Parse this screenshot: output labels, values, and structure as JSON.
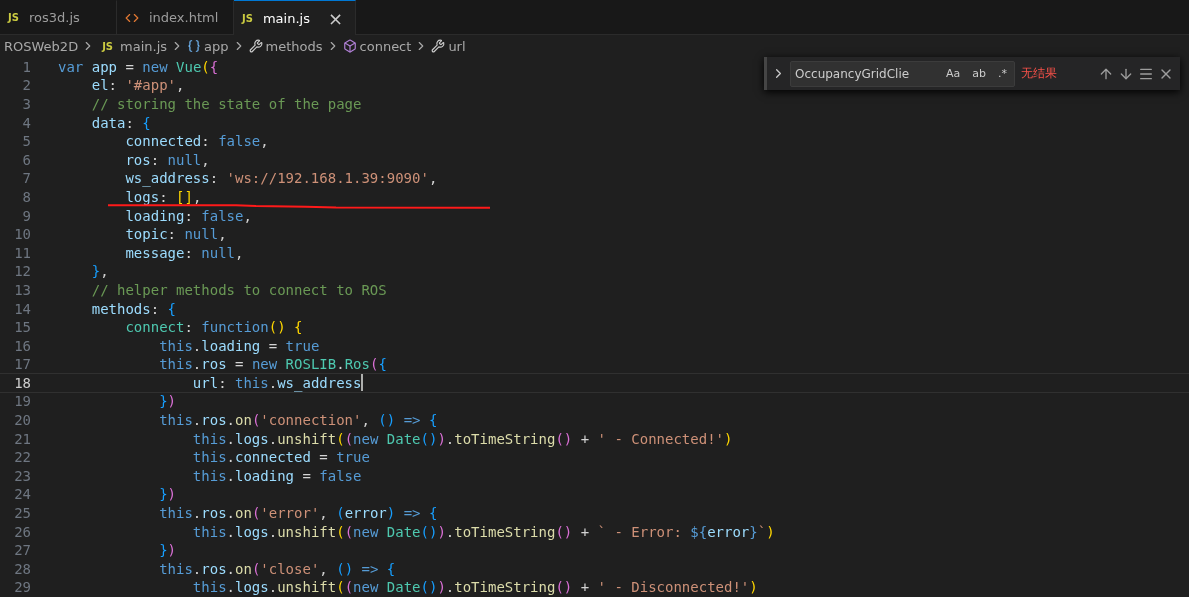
{
  "tabs": [
    {
      "label": "ros3d.js",
      "kind": "js",
      "icon_text": "JS",
      "selected": false
    },
    {
      "label": "index.html",
      "kind": "html",
      "selected": false
    },
    {
      "label": "main.js",
      "kind": "js",
      "icon_text": "JS",
      "selected": true,
      "close": "×"
    }
  ],
  "breadcrumb": [
    {
      "label": "ROSWeb2D",
      "kind": "folder"
    },
    {
      "label": "main.js",
      "kind": "js",
      "icon_text": "JS"
    },
    {
      "label": "app",
      "kind": "variable"
    },
    {
      "label": "methods",
      "kind": "wrench"
    },
    {
      "label": "connect",
      "kind": "cube"
    },
    {
      "label": "url",
      "kind": "wrench"
    }
  ],
  "find_widget": {
    "value": "OccupancyGridClie",
    "toggles": [
      {
        "label": "Aa",
        "selected": false
      },
      {
        "label": "ab",
        "selected": false
      },
      {
        "label": ".*",
        "selected": false
      }
    ],
    "status": "无结果"
  },
  "code_lines": [
    {
      "number": "1",
      "selected": false,
      "tokens": [
        {
          "kind": "kw",
          "text": "var"
        },
        {
          "kind": "var",
          "text": " app"
        },
        {
          "kind": "p",
          "text": " = "
        },
        {
          "kind": "kw",
          "text": "new"
        },
        {
          "kind": "cls",
          "text": " Vue"
        },
        {
          "kind": "b1",
          "text": "("
        },
        {
          "kind": "b2",
          "text": "{"
        }
      ]
    },
    {
      "number": "2",
      "selected": false,
      "tokens": [
        {
          "kind": "var",
          "text": "    el"
        },
        {
          "kind": "p",
          "text": ": "
        },
        {
          "kind": "str",
          "text": "'#app'"
        },
        {
          "kind": "p",
          "text": ","
        }
      ]
    },
    {
      "number": "3",
      "selected": false,
      "tokens": [
        {
          "kind": "com",
          "text": "    // storing the state of the page"
        }
      ]
    },
    {
      "number": "4",
      "selected": false,
      "tokens": [
        {
          "kind": "var",
          "text": "    data"
        },
        {
          "kind": "p",
          "text": ": "
        },
        {
          "kind": "b3",
          "text": "{"
        }
      ]
    },
    {
      "number": "5",
      "selected": false,
      "tokens": [
        {
          "kind": "var",
          "text": "        connected"
        },
        {
          "kind": "p",
          "text": ": "
        },
        {
          "kind": "kw",
          "text": "false"
        },
        {
          "kind": "p",
          "text": ","
        }
      ]
    },
    {
      "number": "6",
      "selected": false,
      "tokens": [
        {
          "kind": "var",
          "text": "        ros"
        },
        {
          "kind": "p",
          "text": ": "
        },
        {
          "kind": "kw",
          "text": "null"
        },
        {
          "kind": "p",
          "text": ","
        }
      ]
    },
    {
      "number": "7",
      "selected": false,
      "tokens": [
        {
          "kind": "var",
          "text": "        ws_address"
        },
        {
          "kind": "p",
          "text": ": "
        },
        {
          "kind": "str",
          "text": "'ws://192.168.1.39:9090'"
        },
        {
          "kind": "p",
          "text": ","
        }
      ]
    },
    {
      "number": "8",
      "selected": false,
      "tokens": [
        {
          "kind": "var",
          "text": "        logs"
        },
        {
          "kind": "p",
          "text": ": "
        },
        {
          "kind": "b1",
          "text": "[]"
        },
        {
          "kind": "p",
          "text": ","
        }
      ]
    },
    {
      "number": "9",
      "selected": false,
      "tokens": [
        {
          "kind": "var",
          "text": "        loading"
        },
        {
          "kind": "p",
          "text": ": "
        },
        {
          "kind": "kw",
          "text": "false"
        },
        {
          "kind": "p",
          "text": ","
        }
      ]
    },
    {
      "number": "10",
      "selected": false,
      "tokens": [
        {
          "kind": "var",
          "text": "        topic"
        },
        {
          "kind": "p",
          "text": ": "
        },
        {
          "kind": "kw",
          "text": "null"
        },
        {
          "kind": "p",
          "text": ","
        }
      ]
    },
    {
      "number": "11",
      "selected": false,
      "tokens": [
        {
          "kind": "var",
          "text": "        message"
        },
        {
          "kind": "p",
          "text": ": "
        },
        {
          "kind": "kw",
          "text": "null"
        },
        {
          "kind": "p",
          "text": ","
        }
      ]
    },
    {
      "number": "12",
      "selected": false,
      "tokens": [
        {
          "kind": "b3",
          "text": "    }"
        },
        {
          "kind": "p",
          "text": ","
        }
      ]
    },
    {
      "number": "13",
      "selected": false,
      "tokens": [
        {
          "kind": "com",
          "text": "    // helper methods to connect to ROS"
        }
      ]
    },
    {
      "number": "14",
      "selected": false,
      "tokens": [
        {
          "kind": "var",
          "text": "    methods"
        },
        {
          "kind": "p",
          "text": ": "
        },
        {
          "kind": "b3",
          "text": "{"
        }
      ]
    },
    {
      "number": "15",
      "selected": false,
      "tokens": [
        {
          "kind": "cls",
          "text": "        connect"
        },
        {
          "kind": "p",
          "text": ": "
        },
        {
          "kind": "kw",
          "text": "function"
        },
        {
          "kind": "b1",
          "text": "()"
        },
        {
          "kind": "b1",
          "text": " {"
        }
      ]
    },
    {
      "number": "16",
      "selected": false,
      "tokens": [
        {
          "kind": "kw",
          "text": "            this"
        },
        {
          "kind": "p",
          "text": "."
        },
        {
          "kind": "var",
          "text": "loading"
        },
        {
          "kind": "p",
          "text": " = "
        },
        {
          "kind": "kw",
          "text": "true"
        }
      ]
    },
    {
      "number": "17",
      "selected": false,
      "tokens": [
        {
          "kind": "kw",
          "text": "            this"
        },
        {
          "kind": "p",
          "text": "."
        },
        {
          "kind": "var",
          "text": "ros"
        },
        {
          "kind": "p",
          "text": " = "
        },
        {
          "kind": "kw",
          "text": "new"
        },
        {
          "kind": "cls",
          "text": " ROSLIB"
        },
        {
          "kind": "p",
          "text": "."
        },
        {
          "kind": "cls",
          "text": "Ros"
        },
        {
          "kind": "b2",
          "text": "("
        },
        {
          "kind": "b3",
          "text": "{"
        }
      ]
    },
    {
      "number": "18",
      "selected": true,
      "tokens": [
        {
          "kind": "var",
          "text": "                url"
        },
        {
          "kind": "p",
          "text": ": "
        },
        {
          "kind": "kw",
          "text": "this"
        },
        {
          "kind": "p",
          "text": "."
        },
        {
          "kind": "var",
          "text": "ws_address"
        }
      ]
    },
    {
      "number": "19",
      "selected": false,
      "tokens": [
        {
          "kind": "b3",
          "text": "            }"
        },
        {
          "kind": "b2",
          "text": ")"
        }
      ]
    },
    {
      "number": "20",
      "selected": false,
      "tokens": [
        {
          "kind": "kw",
          "text": "            this"
        },
        {
          "kind": "p",
          "text": "."
        },
        {
          "kind": "var",
          "text": "ros"
        },
        {
          "kind": "p",
          "text": "."
        },
        {
          "kind": "fn",
          "text": "on"
        },
        {
          "kind": "b2",
          "text": "("
        },
        {
          "kind": "str",
          "text": "'connection'"
        },
        {
          "kind": "p",
          "text": ", "
        },
        {
          "kind": "b3",
          "text": "()"
        },
        {
          "kind": "kw",
          "text": " => "
        },
        {
          "kind": "b3",
          "text": "{"
        }
      ]
    },
    {
      "number": "21",
      "selected": false,
      "tokens": [
        {
          "kind": "kw",
          "text": "                this"
        },
        {
          "kind": "p",
          "text": "."
        },
        {
          "kind": "var",
          "text": "logs"
        },
        {
          "kind": "p",
          "text": "."
        },
        {
          "kind": "fn",
          "text": "unshift"
        },
        {
          "kind": "b1",
          "text": "("
        },
        {
          "kind": "b2",
          "text": "("
        },
        {
          "kind": "kw",
          "text": "new"
        },
        {
          "kind": "cls",
          "text": " Date"
        },
        {
          "kind": "b3",
          "text": "()"
        },
        {
          "kind": "b2",
          "text": ")"
        },
        {
          "kind": "p",
          "text": "."
        },
        {
          "kind": "fn",
          "text": "toTimeString"
        },
        {
          "kind": "b2",
          "text": "()"
        },
        {
          "kind": "p",
          "text": " + "
        },
        {
          "kind": "str",
          "text": "' - Connected!'"
        },
        {
          "kind": "b1",
          "text": ")"
        }
      ]
    },
    {
      "number": "22",
      "selected": false,
      "tokens": [
        {
          "kind": "kw",
          "text": "                this"
        },
        {
          "kind": "p",
          "text": "."
        },
        {
          "kind": "var",
          "text": "connected"
        },
        {
          "kind": "p",
          "text": " = "
        },
        {
          "kind": "kw",
          "text": "true"
        }
      ]
    },
    {
      "number": "23",
      "selected": false,
      "tokens": [
        {
          "kind": "kw",
          "text": "                this"
        },
        {
          "kind": "p",
          "text": "."
        },
        {
          "kind": "var",
          "text": "loading"
        },
        {
          "kind": "p",
          "text": " = "
        },
        {
          "kind": "kw",
          "text": "false"
        }
      ]
    },
    {
      "number": "24",
      "selected": false,
      "tokens": [
        {
          "kind": "b3",
          "text": "            }"
        },
        {
          "kind": "b2",
          "text": ")"
        }
      ]
    },
    {
      "number": "25",
      "selected": false,
      "tokens": [
        {
          "kind": "kw",
          "text": "            this"
        },
        {
          "kind": "p",
          "text": "."
        },
        {
          "kind": "var",
          "text": "ros"
        },
        {
          "kind": "p",
          "text": "."
        },
        {
          "kind": "fn",
          "text": "on"
        },
        {
          "kind": "b2",
          "text": "("
        },
        {
          "kind": "str",
          "text": "'error'"
        },
        {
          "kind": "p",
          "text": ", "
        },
        {
          "kind": "b3",
          "text": "("
        },
        {
          "kind": "var",
          "text": "error"
        },
        {
          "kind": "b3",
          "text": ")"
        },
        {
          "kind": "kw",
          "text": " => "
        },
        {
          "kind": "b3",
          "text": "{"
        }
      ]
    },
    {
      "number": "26",
      "selected": false,
      "tokens": [
        {
          "kind": "kw",
          "text": "                this"
        },
        {
          "kind": "p",
          "text": "."
        },
        {
          "kind": "var",
          "text": "logs"
        },
        {
          "kind": "p",
          "text": "."
        },
        {
          "kind": "fn",
          "text": "unshift"
        },
        {
          "kind": "b1",
          "text": "("
        },
        {
          "kind": "b2",
          "text": "("
        },
        {
          "kind": "kw",
          "text": "new"
        },
        {
          "kind": "cls",
          "text": " Date"
        },
        {
          "kind": "b3",
          "text": "()"
        },
        {
          "kind": "b2",
          "text": ")"
        },
        {
          "kind": "p",
          "text": "."
        },
        {
          "kind": "fn",
          "text": "toTimeString"
        },
        {
          "kind": "b2",
          "text": "()"
        },
        {
          "kind": "p",
          "text": " + "
        },
        {
          "kind": "str",
          "text": "` - Error: "
        },
        {
          "kind": "kw",
          "text": "${"
        },
        {
          "kind": "var",
          "text": "error"
        },
        {
          "kind": "kw",
          "text": "}"
        },
        {
          "kind": "str",
          "text": "`"
        },
        {
          "kind": "b1",
          "text": ")"
        }
      ]
    },
    {
      "number": "27",
      "selected": false,
      "tokens": [
        {
          "kind": "b3",
          "text": "            }"
        },
        {
          "kind": "b2",
          "text": ")"
        }
      ]
    },
    {
      "number": "28",
      "selected": false,
      "tokens": [
        {
          "kind": "kw",
          "text": "            this"
        },
        {
          "kind": "p",
          "text": "."
        },
        {
          "kind": "var",
          "text": "ros"
        },
        {
          "kind": "p",
          "text": "."
        },
        {
          "kind": "fn",
          "text": "on"
        },
        {
          "kind": "b2",
          "text": "("
        },
        {
          "kind": "str",
          "text": "'close'"
        },
        {
          "kind": "p",
          "text": ", "
        },
        {
          "kind": "b3",
          "text": "()"
        },
        {
          "kind": "kw",
          "text": " => "
        },
        {
          "kind": "b3",
          "text": "{"
        }
      ]
    },
    {
      "number": "29",
      "selected": false,
      "tokens": [
        {
          "kind": "kw",
          "text": "                this"
        },
        {
          "kind": "p",
          "text": "."
        },
        {
          "kind": "var",
          "text": "logs"
        },
        {
          "kind": "p",
          "text": "."
        },
        {
          "kind": "fn",
          "text": "unshift"
        },
        {
          "kind": "b1",
          "text": "("
        },
        {
          "kind": "b2",
          "text": "("
        },
        {
          "kind": "kw",
          "text": "new"
        },
        {
          "kind": "cls",
          "text": " Date"
        },
        {
          "kind": "b3",
          "text": "()"
        },
        {
          "kind": "b2",
          "text": ")"
        },
        {
          "kind": "p",
          "text": "."
        },
        {
          "kind": "fn",
          "text": "toTimeString"
        },
        {
          "kind": "b2",
          "text": "()"
        },
        {
          "kind": "p",
          "text": " + "
        },
        {
          "kind": "str",
          "text": "' - Disconnected!'"
        },
        {
          "kind": "b1",
          "text": ")"
        }
      ]
    }
  ]
}
